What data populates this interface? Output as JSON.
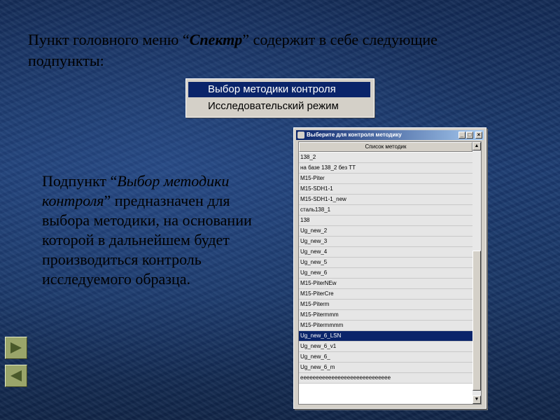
{
  "slide": {
    "heading_prefix": "Пункт головного меню “",
    "heading_em": "Спектр",
    "heading_suffix": "” содержит в себе следующие подпункты:",
    "body_prefix": "Подпункт “",
    "body_em": "Выбор методики контроля",
    "body_suffix": "” предназначен для выбора методики, на основании которой в дальнейшем будет производиться контроль исследуемого образца."
  },
  "menu": {
    "items": [
      {
        "label": "Выбор методики контроля",
        "selected": true
      },
      {
        "label": "Исследовательский режим",
        "selected": false
      }
    ]
  },
  "dialog": {
    "title": "Выберите для контроля методику",
    "buttons": {
      "minimize": "_",
      "maximize": "□",
      "close": "×"
    },
    "column_header": "Список методик",
    "selected_index": 17,
    "items": [
      "138_2",
      "на базе 138_2 без ТТ",
      "M15-Piter",
      "M15-SDH1-1",
      "M15-SDH1-1_new",
      "сталь138_1",
      "138",
      "Ug_new_2",
      "Ug_new_3",
      "Ug_new_4",
      "Ug_new_5",
      "Ug_new_6",
      "M15-PiterNEw",
      "M15-PiterCre",
      "M15-Piterm",
      "M15-Pitermmm",
      "M15-Pitermmmm",
      "Ug_new_6_LSN",
      "Ug_new_6_v1",
      "Ug_new_6_",
      "Ug_new_6_m",
      "eeeeeeeeeeeeeeeeeeeeeeeeeeeee"
    ]
  },
  "nav": {
    "next_icon": "triangle-right-icon",
    "prev_icon": "triangle-left-icon"
  },
  "colors": {
    "background": "#1d3d72",
    "selection": "#0a246a",
    "nav_button": "#9aa56a"
  }
}
